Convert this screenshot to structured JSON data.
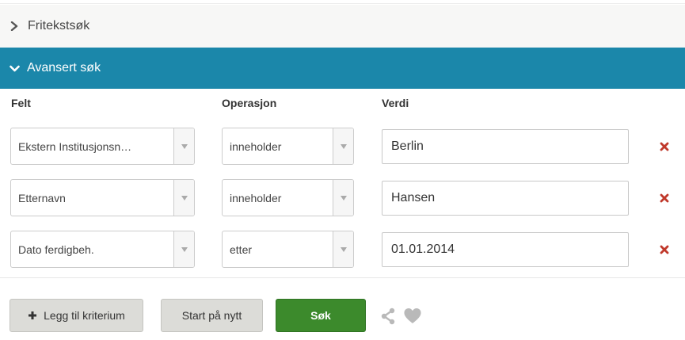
{
  "colors": {
    "accent_header": "#1b87aa",
    "remove_x": "#c0392b",
    "search_button": "#3c8a2c",
    "icon_grey": "#b9b9b9"
  },
  "panels": {
    "free_text": {
      "label": "Fritekstsøk",
      "icon": "chevron-right-icon"
    },
    "advanced": {
      "label": "Avansert søk",
      "icon": "chevron-down-icon"
    }
  },
  "columns": {
    "field": "Felt",
    "operation": "Operasjon",
    "value": "Verdi"
  },
  "criteria": [
    {
      "field": "Ekstern Institusjonsn…",
      "operation": "inneholder",
      "value": "Berlin"
    },
    {
      "field": "Etternavn",
      "operation": "inneholder",
      "value": "Hansen"
    },
    {
      "field": "Dato ferdigbeh.",
      "operation": "etter",
      "value": "01.01.2014"
    }
  ],
  "actions": {
    "add_criterion": "Legg til kriterium",
    "reset": "Start på nytt",
    "search": "Søk"
  },
  "icons": {
    "share": "share-icon",
    "favorite": "heart-icon",
    "remove": "remove-x-icon",
    "dropdown": "caret-down-icon",
    "add": "plus-icon"
  }
}
